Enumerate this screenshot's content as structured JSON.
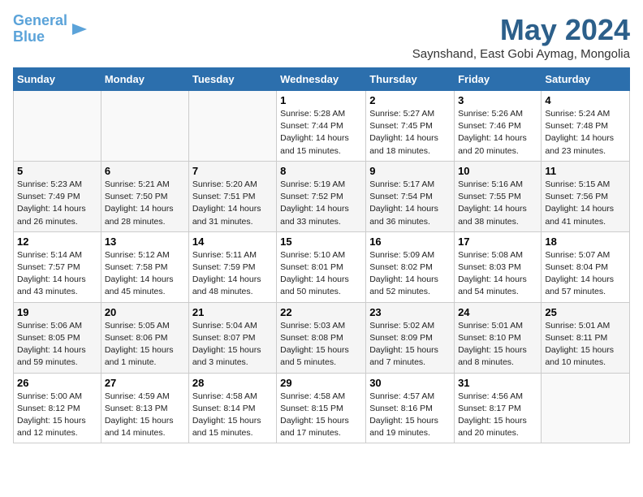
{
  "header": {
    "logo_line1": "General",
    "logo_line2": "Blue",
    "month_title": "May 2024",
    "subtitle": "Saynshand, East Gobi Aymag, Mongolia"
  },
  "days_of_week": [
    "Sunday",
    "Monday",
    "Tuesday",
    "Wednesday",
    "Thursday",
    "Friday",
    "Saturday"
  ],
  "weeks": [
    [
      {
        "day": "",
        "info": ""
      },
      {
        "day": "",
        "info": ""
      },
      {
        "day": "",
        "info": ""
      },
      {
        "day": "1",
        "info": "Sunrise: 5:28 AM\nSunset: 7:44 PM\nDaylight: 14 hours\nand 15 minutes."
      },
      {
        "day": "2",
        "info": "Sunrise: 5:27 AM\nSunset: 7:45 PM\nDaylight: 14 hours\nand 18 minutes."
      },
      {
        "day": "3",
        "info": "Sunrise: 5:26 AM\nSunset: 7:46 PM\nDaylight: 14 hours\nand 20 minutes."
      },
      {
        "day": "4",
        "info": "Sunrise: 5:24 AM\nSunset: 7:48 PM\nDaylight: 14 hours\nand 23 minutes."
      }
    ],
    [
      {
        "day": "5",
        "info": "Sunrise: 5:23 AM\nSunset: 7:49 PM\nDaylight: 14 hours\nand 26 minutes."
      },
      {
        "day": "6",
        "info": "Sunrise: 5:21 AM\nSunset: 7:50 PM\nDaylight: 14 hours\nand 28 minutes."
      },
      {
        "day": "7",
        "info": "Sunrise: 5:20 AM\nSunset: 7:51 PM\nDaylight: 14 hours\nand 31 minutes."
      },
      {
        "day": "8",
        "info": "Sunrise: 5:19 AM\nSunset: 7:52 PM\nDaylight: 14 hours\nand 33 minutes."
      },
      {
        "day": "9",
        "info": "Sunrise: 5:17 AM\nSunset: 7:54 PM\nDaylight: 14 hours\nand 36 minutes."
      },
      {
        "day": "10",
        "info": "Sunrise: 5:16 AM\nSunset: 7:55 PM\nDaylight: 14 hours\nand 38 minutes."
      },
      {
        "day": "11",
        "info": "Sunrise: 5:15 AM\nSunset: 7:56 PM\nDaylight: 14 hours\nand 41 minutes."
      }
    ],
    [
      {
        "day": "12",
        "info": "Sunrise: 5:14 AM\nSunset: 7:57 PM\nDaylight: 14 hours\nand 43 minutes."
      },
      {
        "day": "13",
        "info": "Sunrise: 5:12 AM\nSunset: 7:58 PM\nDaylight: 14 hours\nand 45 minutes."
      },
      {
        "day": "14",
        "info": "Sunrise: 5:11 AM\nSunset: 7:59 PM\nDaylight: 14 hours\nand 48 minutes."
      },
      {
        "day": "15",
        "info": "Sunrise: 5:10 AM\nSunset: 8:01 PM\nDaylight: 14 hours\nand 50 minutes."
      },
      {
        "day": "16",
        "info": "Sunrise: 5:09 AM\nSunset: 8:02 PM\nDaylight: 14 hours\nand 52 minutes."
      },
      {
        "day": "17",
        "info": "Sunrise: 5:08 AM\nSunset: 8:03 PM\nDaylight: 14 hours\nand 54 minutes."
      },
      {
        "day": "18",
        "info": "Sunrise: 5:07 AM\nSunset: 8:04 PM\nDaylight: 14 hours\nand 57 minutes."
      }
    ],
    [
      {
        "day": "19",
        "info": "Sunrise: 5:06 AM\nSunset: 8:05 PM\nDaylight: 14 hours\nand 59 minutes."
      },
      {
        "day": "20",
        "info": "Sunrise: 5:05 AM\nSunset: 8:06 PM\nDaylight: 15 hours\nand 1 minute."
      },
      {
        "day": "21",
        "info": "Sunrise: 5:04 AM\nSunset: 8:07 PM\nDaylight: 15 hours\nand 3 minutes."
      },
      {
        "day": "22",
        "info": "Sunrise: 5:03 AM\nSunset: 8:08 PM\nDaylight: 15 hours\nand 5 minutes."
      },
      {
        "day": "23",
        "info": "Sunrise: 5:02 AM\nSunset: 8:09 PM\nDaylight: 15 hours\nand 7 minutes."
      },
      {
        "day": "24",
        "info": "Sunrise: 5:01 AM\nSunset: 8:10 PM\nDaylight: 15 hours\nand 8 minutes."
      },
      {
        "day": "25",
        "info": "Sunrise: 5:01 AM\nSunset: 8:11 PM\nDaylight: 15 hours\nand 10 minutes."
      }
    ],
    [
      {
        "day": "26",
        "info": "Sunrise: 5:00 AM\nSunset: 8:12 PM\nDaylight: 15 hours\nand 12 minutes."
      },
      {
        "day": "27",
        "info": "Sunrise: 4:59 AM\nSunset: 8:13 PM\nDaylight: 15 hours\nand 14 minutes."
      },
      {
        "day": "28",
        "info": "Sunrise: 4:58 AM\nSunset: 8:14 PM\nDaylight: 15 hours\nand 15 minutes."
      },
      {
        "day": "29",
        "info": "Sunrise: 4:58 AM\nSunset: 8:15 PM\nDaylight: 15 hours\nand 17 minutes."
      },
      {
        "day": "30",
        "info": "Sunrise: 4:57 AM\nSunset: 8:16 PM\nDaylight: 15 hours\nand 19 minutes."
      },
      {
        "day": "31",
        "info": "Sunrise: 4:56 AM\nSunset: 8:17 PM\nDaylight: 15 hours\nand 20 minutes."
      },
      {
        "day": "",
        "info": ""
      }
    ]
  ]
}
